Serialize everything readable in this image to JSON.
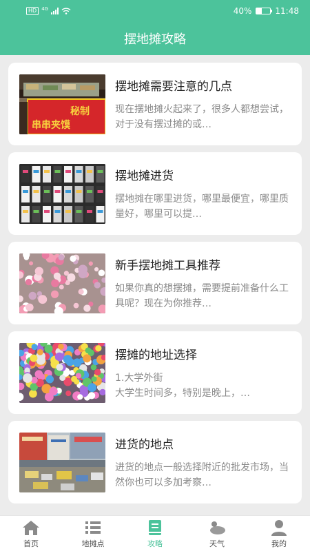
{
  "status": {
    "hd": "HD",
    "network": "4G",
    "battery": "40%",
    "battery_level": 0.4,
    "time": "11:48"
  },
  "header": {
    "title": "摆地摊攻略"
  },
  "articles": [
    {
      "title": "摆地摊需要注意的几点",
      "desc": "现在摆地摊火起来了，很多人都想尝试，对于没有摆过摊的或…",
      "sign_text": "秘制 串串夹馍"
    },
    {
      "title": "摆地摊进货",
      "desc": "摆地摊在哪里进货，哪里最便宜，哪里质量好，哪里可以提…"
    },
    {
      "title": "新手摆地摊工具推荐",
      "desc": "如果你真的想摆摊，需要提前准备什么工具呢？现在为你推荐…"
    },
    {
      "title": "摆摊的地址选择",
      "desc": "1.大学外街\n大学生时间多，特别是晚上，…"
    },
    {
      "title": "进货的地点",
      "desc": "进货的地点一般选择附近的批发市场，当然你也可以多加考察…"
    }
  ],
  "tabs": [
    {
      "label": "首页",
      "icon": "home-icon"
    },
    {
      "label": "地摊点",
      "icon": "list-icon"
    },
    {
      "label": "攻略",
      "icon": "book-icon",
      "active": true
    },
    {
      "label": "天气",
      "icon": "weather-icon"
    },
    {
      "label": "我的",
      "icon": "user-icon"
    }
  ],
  "colors": {
    "accent": "#4cc39b",
    "background": "#ececec"
  }
}
